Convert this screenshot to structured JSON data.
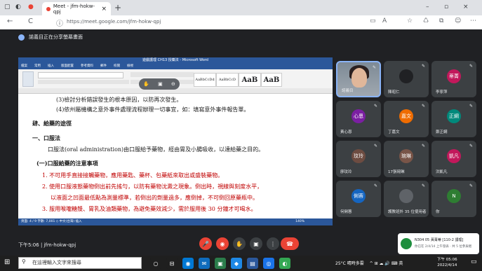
{
  "browser": {
    "tab_title": "Meet - jfm-hokw-qpj",
    "tab_close": "×",
    "new_tab": "+",
    "window_controls": [
      "–",
      "▫",
      "×"
    ],
    "url": "https://meet.google.com/jfm-hokw-qpj",
    "nav_icons": [
      "back-arrow-icon",
      "refresh-icon",
      "info-icon"
    ],
    "nav_glyphs": [
      "←",
      "C",
      "ⓘ"
    ],
    "toolbar_glyphs": [
      "▭",
      "A",
      "☆",
      "♺",
      "⧉",
      "☺",
      "⋯"
    ]
  },
  "meet": {
    "presenting_banner": "諾義目正在分享螢幕畫面",
    "meeting_info": "下午5:06 | jfm-hokw-qpj",
    "float_controls": [
      "✋",
      "▣",
      "⊖"
    ],
    "controls": [
      {
        "name": "mic-button",
        "glyph": "🎤",
        "red": true
      },
      {
        "name": "camera-button",
        "glyph": "◉",
        "red": true
      },
      {
        "name": "raise-hand-button",
        "glyph": "✋",
        "red": false
      },
      {
        "name": "present-button",
        "glyph": "▣",
        "red": false
      },
      {
        "name": "more-options-button",
        "glyph": "⋮",
        "red": false
      },
      {
        "name": "hangup-button",
        "glyph": "☎",
        "red": true
      }
    ]
  },
  "word": {
    "title": "遊戲護理 CH13 授藥法 - Microsoft Word",
    "menu": [
      "檔案",
      "常用",
      "插入",
      "版面配置",
      "參考資料",
      "郵件",
      "校閱",
      "檢視"
    ],
    "styles": [
      "AaBbCcDd",
      "AaBbCcD",
      "AaB",
      "AaB"
    ],
    "status": "頁面: 4 / 9   字數: 7,001   ◇ 中文(台灣)   插入",
    "zoom": "140%",
    "lines": [
      {
        "text": "(3)檢討分析錯誤發生的根本原因，以防再次發生。",
        "red": false
      },
      {
        "text": "(4)依州屬機構之意外事件處理流程辦理一切事宜，如：填寫意外事件報告單。",
        "red": false
      },
      {
        "text": "肆、給藥的途徑",
        "red": false
      },
      {
        "text": "一、口服法",
        "red": false
      },
      {
        "text": "口服法(oral administration)由口服給予藥物，經由胃及小腸吸收，以達給藥之目的。",
        "red": false
      },
      {
        "text": "(一)口服給藥的注意事項",
        "red": false
      },
      {
        "text": "1. 不可用手直接接觸藥物，應用藥匙、藥杯、包藥紙來取出或盛裝藥物。",
        "red": true
      },
      {
        "text": "2. 使用口服液態藥物倒出前先搖勻，以防有藥物沈澱之現象。倒出時，視線與刻度水平，",
        "red": true
      },
      {
        "text": "以液面之凹面最低點為測量標準，若倒出的劑量過多，應倒掉，不可倒回原藥瓶中。",
        "red": true
      },
      {
        "text": "3. 服用喉嚨糖漿、胃乳及油類藥物，為避免藥效減少，需於服用後 30 分鐘才可喝水。",
        "red": true
      }
    ]
  },
  "tiles": [
    {
      "name": "諾義目",
      "initials": "",
      "color": "",
      "self": true
    },
    {
      "name": "陳昭仁",
      "initials": "",
      "color": "#202124",
      "self": false
    },
    {
      "name": "李寧萍",
      "initials": "蒂菁",
      "color": "#c2185b",
      "self": false
    },
    {
      "name": "黃心恩",
      "initials": "心恩",
      "color": "#7b1fa2",
      "self": false
    },
    {
      "name": "丁嘉文",
      "initials": "嘉文",
      "color": "#ef6c00",
      "self": false
    },
    {
      "name": "鄭正綱",
      "initials": "正綱",
      "color": "#00897b",
      "self": false
    },
    {
      "name": "廖玟玲",
      "initials": "玟玲",
      "color": "#6d4c41",
      "self": false
    },
    {
      "name": "17張琬琳",
      "initials": "琬琳",
      "color": "#795548",
      "self": false
    },
    {
      "name": "洪凱凡",
      "initials": "凱凡",
      "color": "#c2185b",
      "self": false
    },
    {
      "name": "何俐蓉",
      "initials": "俐蓉",
      "color": "#1565c0",
      "self": false
    },
    {
      "name": "護教班外 35 位使用者",
      "initials": "",
      "color": "#5f6368",
      "self": false
    },
    {
      "name": "你",
      "initials": "N",
      "color": "#2e7d32",
      "self": false
    }
  ],
  "notification": {
    "title": "N304 05 黃菁蒂 [110-2 護理]",
    "subtitle": "你已在 2/4/14 上午發表 · 共 5 位參與者"
  },
  "taskbar": {
    "start_glyph": "⊞",
    "search_placeholder": "在這裡輸入文字來搜尋",
    "search_glyph": "⚲",
    "app_glyphs": [
      "○",
      "⊟",
      "◉",
      "✉",
      "▣",
      "◆",
      "▤",
      "◎",
      "◐"
    ],
    "weather": "25°C 晴時多雲",
    "tray": "^ ⊞ ☁ 🔊 ⌨ 英",
    "time": "下午 05:06",
    "date": "2022/4/14"
  }
}
